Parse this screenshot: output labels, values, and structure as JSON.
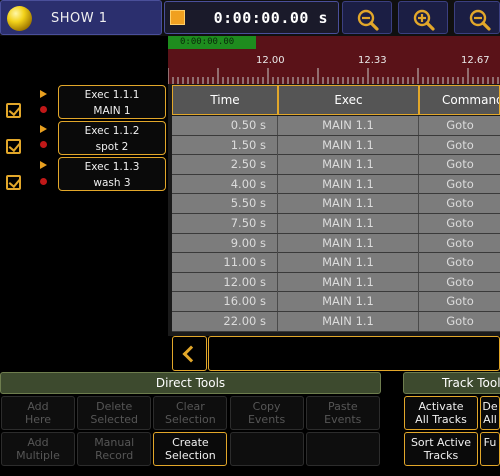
{
  "header": {
    "show_label": "SHOW 1",
    "clock_time": "0:00:00.00 s",
    "zoom_buttons": [
      {
        "name": "zoom-out-button",
        "icon": "zoom-out-icon"
      },
      {
        "name": "zoom-in-button",
        "icon": "zoom-in-icon"
      },
      {
        "name": "zoom-fit-button",
        "icon": "zoom-icon"
      }
    ]
  },
  "timeline": {
    "timecode": "0:00:00.00",
    "ticks": [
      "12.00",
      "12.33",
      "12.67"
    ]
  },
  "tracks": [
    {
      "line1": "Exec 1.1.1",
      "line2": "MAIN 1"
    },
    {
      "line1": "Exec 1.1.2",
      "line2": "spot 2"
    },
    {
      "line1": "Exec 1.1.3",
      "line2": "wash 3"
    }
  ],
  "table": {
    "headers": [
      "Time",
      "Exec",
      "Command"
    ],
    "rows": [
      {
        "time": "0.50 s",
        "exec": "MAIN 1.1",
        "cmd": "Goto"
      },
      {
        "time": "1.50 s",
        "exec": "MAIN 1.1",
        "cmd": "Goto"
      },
      {
        "time": "2.50 s",
        "exec": "MAIN 1.1",
        "cmd": "Goto"
      },
      {
        "time": "4.00 s",
        "exec": "MAIN 1.1",
        "cmd": "Goto"
      },
      {
        "time": "5.50 s",
        "exec": "MAIN 1.1",
        "cmd": "Goto"
      },
      {
        "time": "7.50 s",
        "exec": "MAIN 1.1",
        "cmd": "Goto"
      },
      {
        "time": "9.00 s",
        "exec": "MAIN 1.1",
        "cmd": "Goto"
      },
      {
        "time": "11.00 s",
        "exec": "MAIN 1.1",
        "cmd": "Goto"
      },
      {
        "time": "12.00 s",
        "exec": "MAIN 1.1",
        "cmd": "Goto"
      },
      {
        "time": "16.00 s",
        "exec": "MAIN 1.1",
        "cmd": "Goto"
      },
      {
        "time": "22.00 s",
        "exec": "MAIN 1.1",
        "cmd": "Goto"
      }
    ]
  },
  "direct_tools": {
    "title": "Direct Tools",
    "row1": [
      {
        "l1": "Add",
        "l2": "Here",
        "enabled": false
      },
      {
        "l1": "Delete",
        "l2": "Selected",
        "enabled": false
      },
      {
        "l1": "Clear",
        "l2": "Selection",
        "enabled": false
      },
      {
        "l1": "Copy",
        "l2": "Events",
        "enabled": false
      },
      {
        "l1": "Paste",
        "l2": "Events",
        "enabled": false
      }
    ],
    "row2": [
      {
        "l1": "Add",
        "l2": "Multiple",
        "enabled": false
      },
      {
        "l1": "Manual",
        "l2": "Record",
        "enabled": false
      },
      {
        "l1": "Create",
        "l2": "Selection",
        "enabled": true
      },
      {
        "l1": "",
        "l2": "",
        "enabled": false
      },
      {
        "l1": "",
        "l2": "",
        "enabled": false
      }
    ]
  },
  "track_tools": {
    "title": "Track Tools",
    "row1": [
      {
        "l1": "Activate",
        "l2": "All Tracks"
      },
      {
        "l1": "De",
        "l2": "All"
      }
    ],
    "row2": [
      {
        "l1": "Sort Active",
        "l2": "Tracks"
      },
      {
        "l1": "Fu",
        "l2": ""
      }
    ]
  },
  "colors": {
    "accent": "#e2a72a",
    "timeline_bg": "#5a1218",
    "timecode_green": "#1e8c1e",
    "header_blue": "#2b2f6e",
    "tools_header": "#3d4a2e",
    "record_red": "#c01818"
  }
}
